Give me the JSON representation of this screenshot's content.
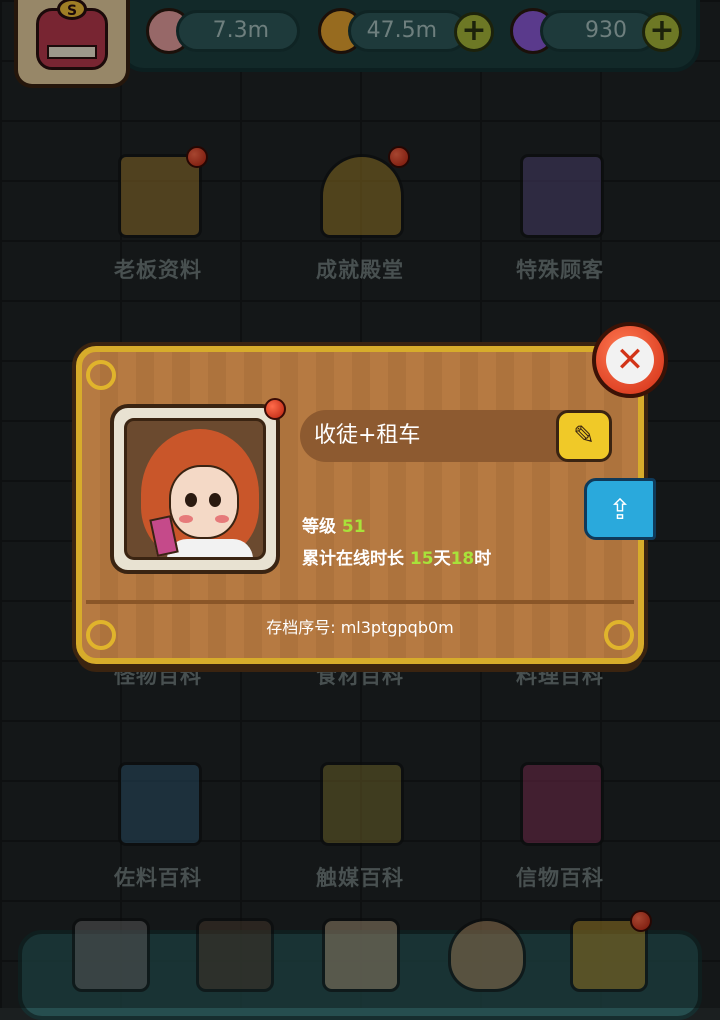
{
  "header": {
    "resources": [
      {
        "icon": "eyeball-icon",
        "value": "7.3m",
        "color": "#e8a0a0"
      },
      {
        "icon": "coin-icon",
        "value": "47.5m",
        "color": "#e8a530"
      },
      {
        "icon": "potion-icon",
        "value": "930",
        "color": "#8a5ad8"
      }
    ],
    "add_label": "+"
  },
  "grid": {
    "items": [
      {
        "label": "老板资料",
        "icon": "boss-profile-icon",
        "color": "#c89a3a",
        "badge": true
      },
      {
        "label": "成就殿堂",
        "icon": "trophy-icon",
        "color": "#c8a030",
        "badge": true
      },
      {
        "label": "特殊顾客",
        "icon": "special-customer-icon",
        "color": "#6a5a9a",
        "badge": false
      },
      {
        "label": "怪物百科",
        "icon": "monster-encyclopedia-icon",
        "color": "#5a6a7a",
        "badge": false
      },
      {
        "label": "食材百科",
        "icon": "ingredient-encyclopedia-icon",
        "color": "#7a6a3a",
        "badge": false
      },
      {
        "label": "料理百科",
        "icon": "cuisine-encyclopedia-icon",
        "color": "#8a4a3a",
        "badge": false
      },
      {
        "label": "佐料百科",
        "icon": "seasoning-encyclopedia-icon",
        "color": "#3a6a8a",
        "badge": false
      },
      {
        "label": "触媒百科",
        "icon": "catalyst-encyclopedia-icon",
        "color": "#9a8a3a",
        "badge": false
      },
      {
        "label": "信物百科",
        "icon": "token-encyclopedia-icon",
        "color": "#a03a6a",
        "badge": false
      }
    ]
  },
  "bottom_nav": {
    "items": [
      {
        "icon": "shop-icon",
        "color": "#7a7a7a"
      },
      {
        "icon": "monster-den-icon",
        "color": "#5a4a3a"
      },
      {
        "icon": "book-icon",
        "color": "#c8b090"
      },
      {
        "icon": "money-bag-icon",
        "color": "#c8a070"
      },
      {
        "icon": "menu-grid-icon",
        "color": "#c8a030"
      }
    ]
  },
  "profile_dialog": {
    "name": "收徒+租车",
    "level_label": "等级",
    "level_value": "51",
    "online_label": "累计在线时长",
    "online_days_value": "15",
    "online_days_unit": "天",
    "online_hours_value": "18",
    "online_hours_unit": "时",
    "save_id": "存档序号: ml3ptgpqb0m",
    "close_label": "✕",
    "edit_label": "✎",
    "share_label": "⇪"
  }
}
